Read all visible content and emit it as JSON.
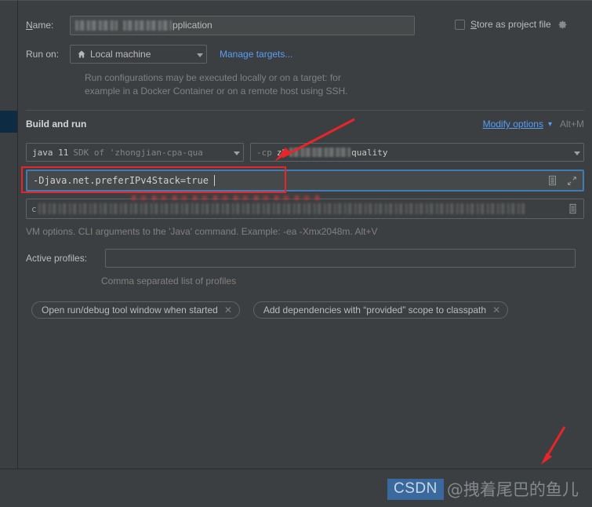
{
  "dialog": {
    "name_label": "Name:",
    "name_label_mnemonic": "N",
    "name_value_suffix": "pplication",
    "store_as_project_file_label": "Store as project file",
    "store_as_project_file_mnemonic": "S",
    "store_as_project_file_checked": false,
    "gear_icon": "gear-icon",
    "run_on_label": "Run on:",
    "run_on_value": "Local machine",
    "run_on_icon": "home-icon",
    "manage_targets_link": "Manage targets...",
    "description_line1": "Run configurations may be executed locally or on a target: for",
    "description_line2": "example in a Docker Container or on a remote host using SSH."
  },
  "build_and_run": {
    "section_title": "Build and run",
    "modify_options_label": "Modify options",
    "modify_options_shortcut": "Alt+M",
    "jdk": {
      "prefix": "java 11",
      "detail": "SDK of 'zhongjian-cpa-qua"
    },
    "classpath": {
      "prefix": "-cp",
      "redacted_head": "zh",
      "suffix": "quality"
    },
    "vm_options": {
      "value": "-Djava.net.preferIPv4Stack=true",
      "expand_icon": "expand-icon",
      "list_icon": "document-list-icon",
      "highlighted": true
    },
    "main_class": {
      "prefix": "c",
      "list_icon": "document-list-icon"
    },
    "vm_hint": "VM options. CLI arguments to the 'Java' command. Example: -ea -Xmx2048m. Alt+V",
    "active_profiles_label": "Active profiles:",
    "active_profiles_value": "",
    "active_profiles_hint": "Comma separated list of profiles",
    "pills": [
      {
        "label": "Open run/debug tool window when started",
        "close_icon": "close-icon"
      },
      {
        "label": "Add dependencies with “provided” scope to classpath",
        "close_icon": "close-icon"
      }
    ]
  },
  "annotations": {
    "highlight_color": "#e8262a",
    "arrow_color": "#e8262a",
    "arrow_top_name": "red-arrow-pointing-to-classpath",
    "arrow_bottom_name": "red-arrow-pointing-to-bottom-right"
  },
  "watermark": {
    "badge": "CSDN",
    "author": "@拽着尾巴的鱼儿"
  },
  "colors": {
    "background": "#3c3f41",
    "field_background": "#45494a",
    "border": "#5e6366",
    "text": "#bbbbbb",
    "muted_text": "#808080",
    "link": "#589df6",
    "selection_navy": "#0d2b42",
    "highlight_red": "#e8262a",
    "focus_blue": "#3f7cb5"
  }
}
